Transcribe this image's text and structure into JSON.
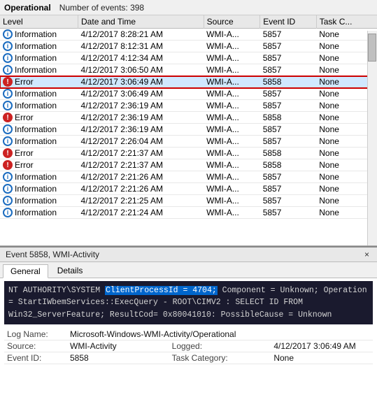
{
  "topbar": {
    "title": "Operational",
    "count_label": "Number of events:",
    "count_value": "398"
  },
  "table": {
    "columns": [
      "Level",
      "Date and Time",
      "Source",
      "Event ID",
      "Task C..."
    ],
    "rows": [
      {
        "level": "Information",
        "level_type": "info",
        "datetime": "4/12/2017 8:28:21 AM",
        "source": "WMI-A...",
        "eventid": "5857",
        "task": "None"
      },
      {
        "level": "Information",
        "level_type": "info",
        "datetime": "4/12/2017 8:12:31 AM",
        "source": "WMI-A...",
        "eventid": "5857",
        "task": "None"
      },
      {
        "level": "Information",
        "level_type": "info",
        "datetime": "4/12/2017 4:12:34 AM",
        "source": "WMI-A...",
        "eventid": "5857",
        "task": "None"
      },
      {
        "level": "Information",
        "level_type": "info",
        "datetime": "4/12/2017 3:06:50 AM",
        "source": "WMI-A...",
        "eventid": "5857",
        "task": "None"
      },
      {
        "level": "Error",
        "level_type": "error",
        "datetime": "4/12/2017 3:06:49 AM",
        "source": "WMI-A...",
        "eventid": "5858",
        "task": "None",
        "selected": true
      },
      {
        "level": "Information",
        "level_type": "info",
        "datetime": "4/12/2017 3:06:49 AM",
        "source": "WMI-A...",
        "eventid": "5857",
        "task": "None"
      },
      {
        "level": "Information",
        "level_type": "info",
        "datetime": "4/12/2017 2:36:19 AM",
        "source": "WMI-A...",
        "eventid": "5857",
        "task": "None"
      },
      {
        "level": "Error",
        "level_type": "error",
        "datetime": "4/12/2017 2:36:19 AM",
        "source": "WMI-A...",
        "eventid": "5858",
        "task": "None"
      },
      {
        "level": "Information",
        "level_type": "info",
        "datetime": "4/12/2017 2:36:19 AM",
        "source": "WMI-A...",
        "eventid": "5857",
        "task": "None"
      },
      {
        "level": "Information",
        "level_type": "info",
        "datetime": "4/12/2017 2:26:04 AM",
        "source": "WMI-A...",
        "eventid": "5857",
        "task": "None"
      },
      {
        "level": "Error",
        "level_type": "error",
        "datetime": "4/12/2017 2:21:37 AM",
        "source": "WMI-A...",
        "eventid": "5858",
        "task": "None"
      },
      {
        "level": "Error",
        "level_type": "error",
        "datetime": "4/12/2017 2:21:37 AM",
        "source": "WMI-A...",
        "eventid": "5858",
        "task": "None"
      },
      {
        "level": "Information",
        "level_type": "info",
        "datetime": "4/12/2017 2:21:26 AM",
        "source": "WMI-A...",
        "eventid": "5857",
        "task": "None"
      },
      {
        "level": "Information",
        "level_type": "info",
        "datetime": "4/12/2017 2:21:26 AM",
        "source": "WMI-A...",
        "eventid": "5857",
        "task": "None"
      },
      {
        "level": "Information",
        "level_type": "info",
        "datetime": "4/12/2017 2:21:25 AM",
        "source": "WMI-A...",
        "eventid": "5857",
        "task": "None"
      },
      {
        "level": "Information",
        "level_type": "info",
        "datetime": "4/12/2017 2:21:24 AM",
        "source": "WMI-A...",
        "eventid": "5857",
        "task": "None"
      }
    ]
  },
  "detail": {
    "header_title": "Event 5858, WMI-Activity",
    "close_label": "×",
    "tabs": [
      "General",
      "Details"
    ],
    "active_tab": "General",
    "message_before_highlight": "NT AUTHORITY\\SYSTEM ",
    "message_highlight": "ClientProcessId = 4704;",
    "message_after": " Component = Unknown; Operation = StartIWbemServices::ExecQuery - ROOT\\CIMV2 : SELECT ID FROM Win32_ServerFeature; ResultCod= 0x80041010: PossibleCause = Unknown",
    "fields": {
      "log_name_label": "Log Name:",
      "log_name_value": "Microsoft-Windows-WMI-Activity/Operational",
      "source_label": "Source:",
      "source_value": "WMI-Activity",
      "logged_label": "Logged:",
      "logged_value": "4/12/2017 3:06:49 AM",
      "event_id_label": "Event ID:",
      "event_id_value": "5858",
      "task_category_label": "Task Category:",
      "task_category_value": "None"
    }
  }
}
